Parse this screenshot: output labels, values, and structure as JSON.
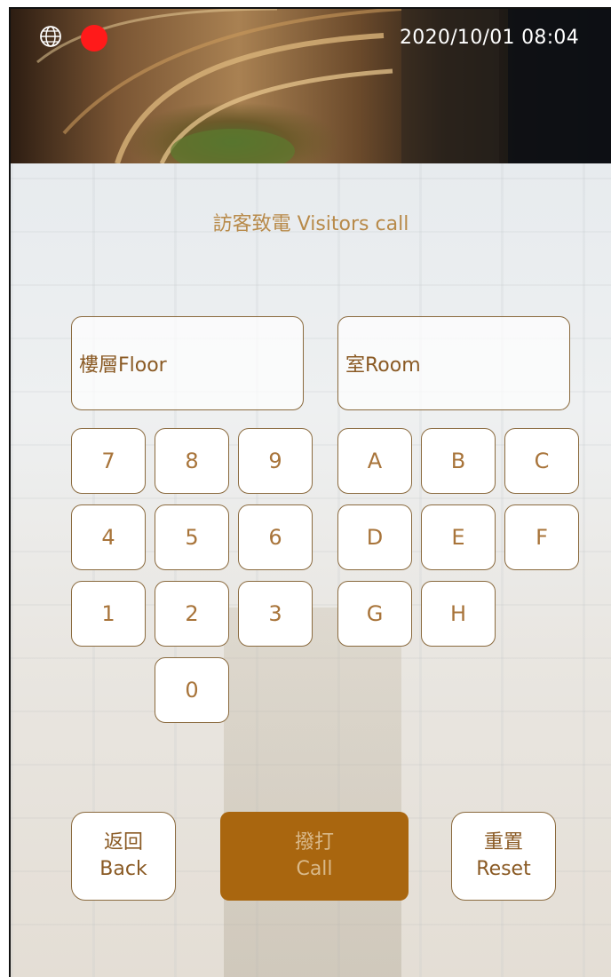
{
  "status_bar": {
    "datetime": "2020/10/01 08:04"
  },
  "title": "訪客致電 Visitors call",
  "fields": {
    "floor_label": "樓層Floor",
    "room_label": "室Room"
  },
  "keypad": {
    "digits": [
      "7",
      "8",
      "9",
      "4",
      "5",
      "6",
      "1",
      "2",
      "3",
      "0"
    ],
    "letters": [
      "A",
      "B",
      "C",
      "D",
      "E",
      "F",
      "G",
      "H"
    ]
  },
  "actions": {
    "back_zh": "返回",
    "back_en": "Back",
    "call_zh": "撥打",
    "call_en": "Call",
    "reset_zh": "重置",
    "reset_en": "Reset"
  },
  "colors": {
    "accent_gold": "#a9660f",
    "text_brown": "#8a5a24",
    "recording_red": "#ff1a1a"
  },
  "icons": {
    "globe": "globe-icon",
    "recording": "recording-indicator"
  }
}
